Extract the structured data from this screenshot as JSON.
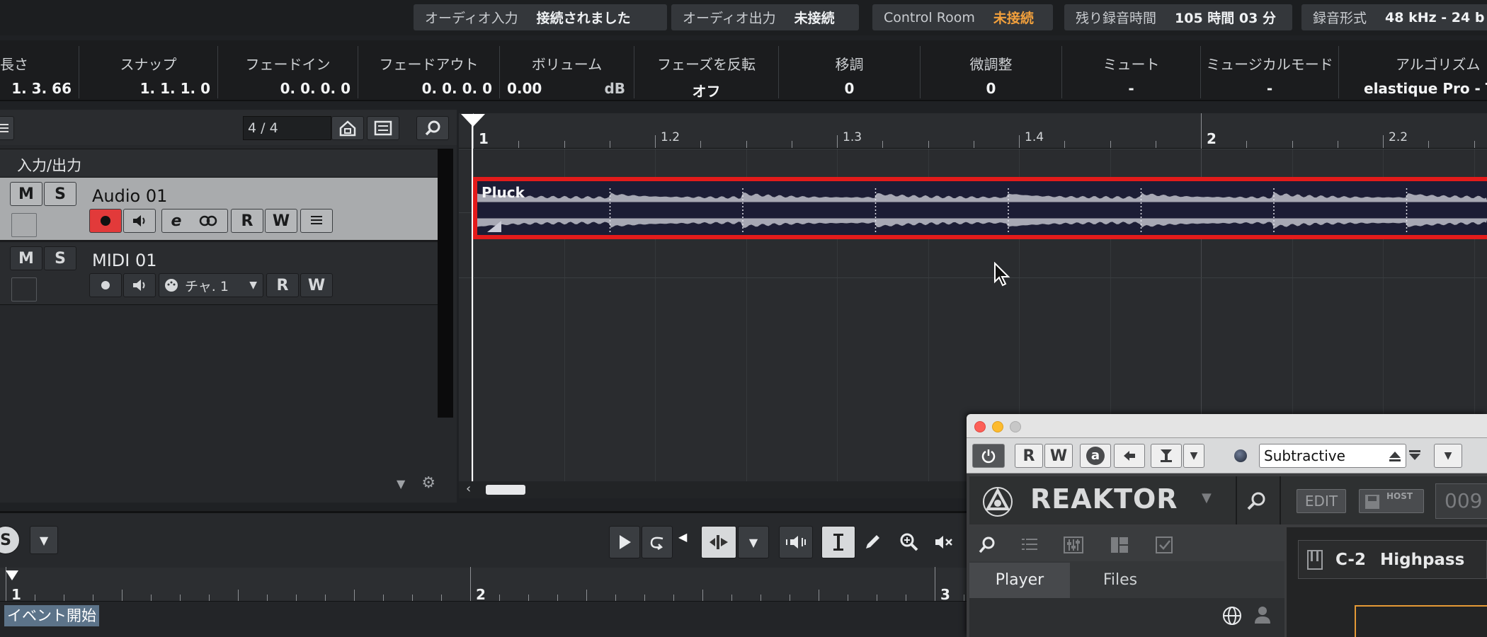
{
  "status_bar": {
    "audio_in": {
      "label": "オーディオ入力",
      "value": "接続されました"
    },
    "audio_out": {
      "label": "オーディオ出力",
      "value": "未接続"
    },
    "control_room": {
      "label": "Control Room",
      "value": "未接続"
    },
    "rec_time": {
      "label": "残り録音時間",
      "value": "105 時間 03 分"
    },
    "rec_format": {
      "label": "録音形式",
      "value": "48 kHz - 24 b"
    }
  },
  "info_line": {
    "length": {
      "label": "長さ",
      "value": "1. 3. 66"
    },
    "snap": {
      "label": "スナップ",
      "value": "1. 1. 1.   0"
    },
    "fade_in": {
      "label": "フェードイン",
      "value": "0. 0. 0.   0"
    },
    "fade_out": {
      "label": "フェードアウト",
      "value": "0. 0. 0.   0"
    },
    "volume": {
      "label": "ボリューム",
      "value": "0.00",
      "unit": "dB"
    },
    "invert_phase": {
      "label": "フェーズを反転",
      "value": "オフ"
    },
    "transpose": {
      "label": "移調",
      "value": "0"
    },
    "fine_tune": {
      "label": "微調整",
      "value": "0"
    },
    "mute": {
      "label": "ミュート",
      "value": "-"
    },
    "musical_mode": {
      "label": "ミュージカルモード",
      "value": "-"
    },
    "algorithm": {
      "label": "アルゴリズム",
      "value": "elastique Pro - Ti"
    }
  },
  "tracklist": {
    "count": "4 / 4",
    "folder": "入力/出力",
    "tracks": [
      {
        "name": "Audio 01",
        "mute": "M",
        "solo": "S",
        "edit": "e",
        "read": "R",
        "write": "W"
      },
      {
        "name": "MIDI 01",
        "mute": "M",
        "solo": "S",
        "channel": "チャ. 1",
        "read": "R",
        "write": "W"
      }
    ]
  },
  "ruler": {
    "labels": [
      "1",
      "1.2",
      "1.3",
      "1.4",
      "2",
      "2.2"
    ]
  },
  "event": {
    "name": "Pluck"
  },
  "lower_zone": {
    "ruler_labels": [
      "1",
      "2",
      "3"
    ],
    "event_start": "イベント開始",
    "solo": "S"
  },
  "reaktor": {
    "read": "R",
    "write": "W",
    "auto": "a",
    "preset": "Subtractive",
    "logo": "REAKTOR",
    "edit": "EDIT",
    "host": "HOST",
    "snapshot": "009",
    "tabs": [
      "Player",
      "Files"
    ],
    "note": "C-2",
    "filter": "Highpass"
  },
  "colors": {
    "accent_orange": "#f2a03c",
    "record_red": "#e23a3a",
    "event_border": "#e31b1b"
  }
}
